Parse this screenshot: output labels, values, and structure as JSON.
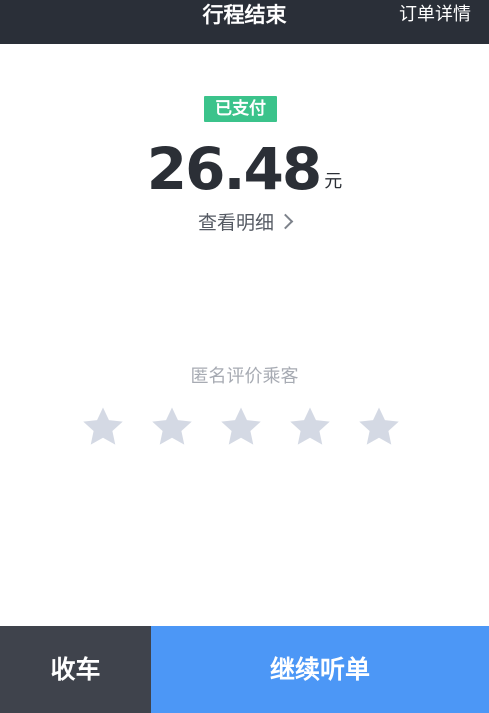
{
  "header": {
    "title": "行程结束",
    "order_details_label": "订单详情"
  },
  "payment": {
    "status_badge": "已支付",
    "amount": "26.48",
    "unit": "元",
    "details_link": "查看明细"
  },
  "rating": {
    "label": "匿名评价乘客",
    "max_stars": 5,
    "selected": 0,
    "star_color": "#d4d9e4"
  },
  "actions": {
    "stop_label": "收车",
    "continue_label": "继续听单"
  },
  "colors": {
    "header_bg": "#2a2f38",
    "badge_bg": "#3bc38b",
    "primary_button": "#4c97f6",
    "secondary_button": "#3f434c"
  }
}
